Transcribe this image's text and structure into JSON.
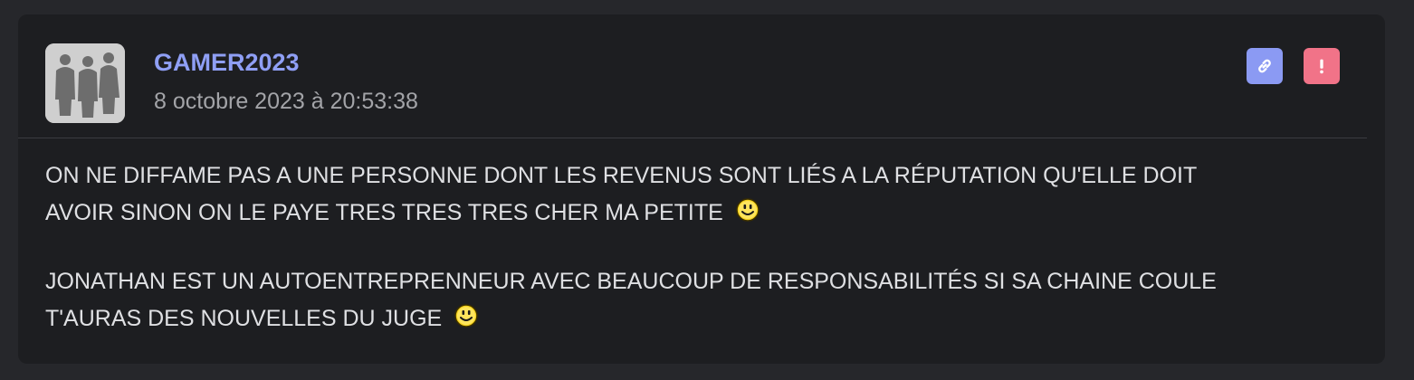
{
  "post": {
    "username": "GAMER2023",
    "date": "8 octobre 2023 à 20:53:38",
    "paragraphs": [
      {
        "line1": "ON NE DIFFAME PAS A UNE PERSONNE DONT LES REVENUS SONT LIÉS A LA RÉPUTATION QU'ELLE DOIT",
        "line2": "AVOIR SINON ON LE PAYE TRES TRES TRES CHER MA PETITE",
        "emoji": "smiley-icon"
      },
      {
        "line1": "JONATHAN EST UN AUTOENTREPRENNEUR AVEC BEAUCOUP DE RESPONSABILITÉS SI SA CHAINE COULE",
        "line2": "T'AURAS DES NOUVELLES DU JUGE",
        "emoji": "smiley-icon"
      }
    ]
  },
  "actions": {
    "link_icon": "link-icon",
    "report_icon": "exclamation-icon"
  },
  "colors": {
    "background": "#26272b",
    "card": "#1d1e21",
    "username": "#8f9ff5",
    "link_button": "#8b9af3",
    "report_button": "#f17388",
    "text": "#dfe0e3",
    "date": "#a3a4a8"
  }
}
